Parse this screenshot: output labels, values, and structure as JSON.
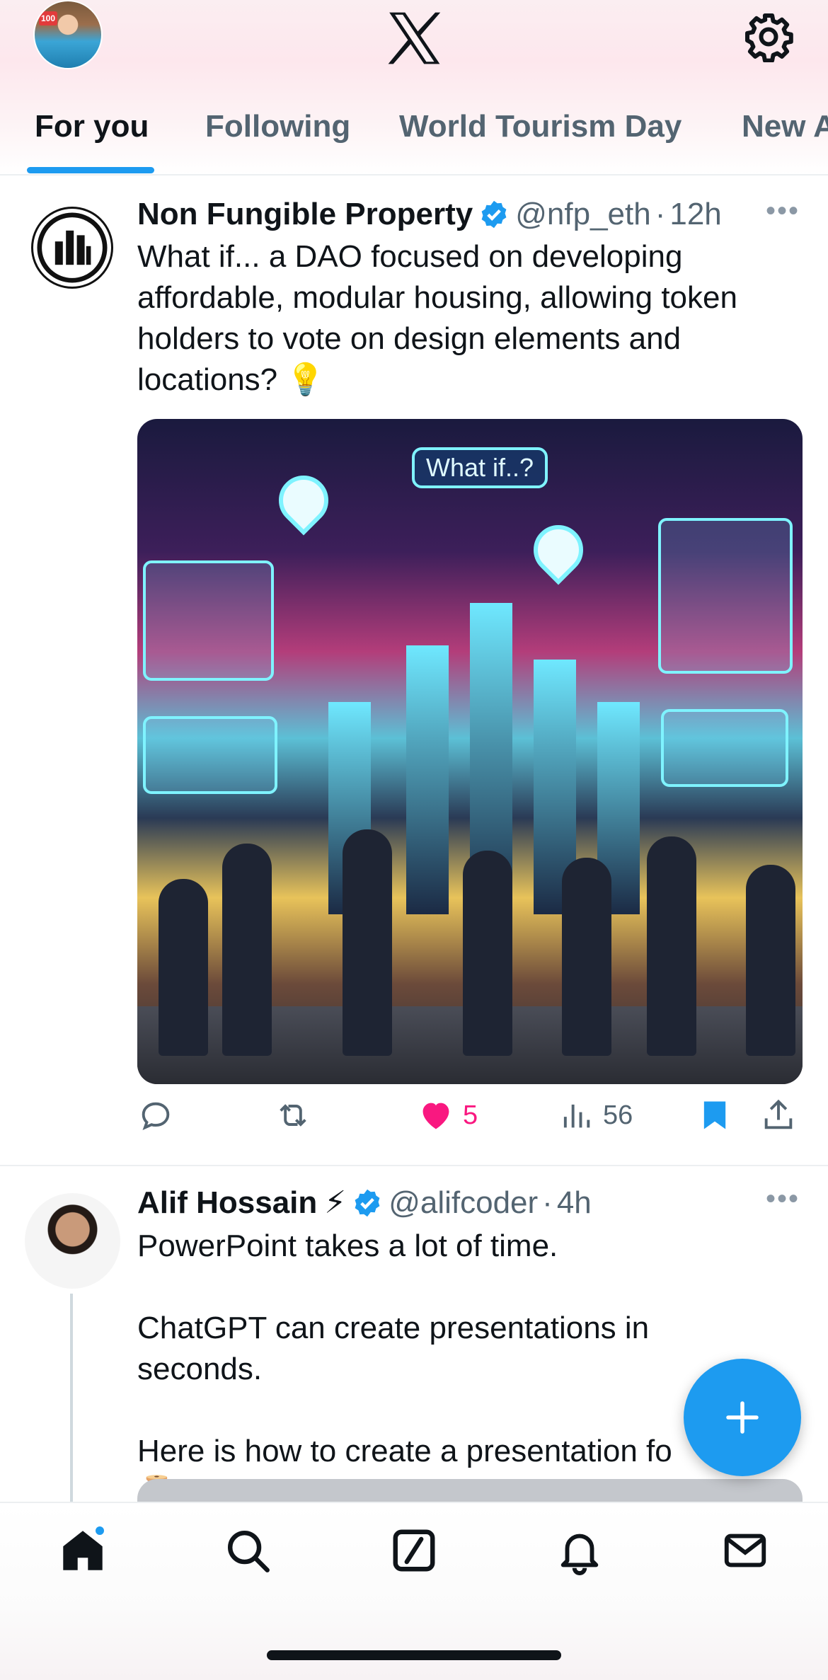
{
  "header": {
    "logo": "x-logo",
    "avatar_badge": "100",
    "settings_icon": "gear-icon"
  },
  "tabs": [
    {
      "label": "For you",
      "active": true
    },
    {
      "label": "Following",
      "active": false
    },
    {
      "label": "World Tourism Day",
      "active": false
    },
    {
      "label": "New A",
      "active": false
    }
  ],
  "posts": [
    {
      "name": "Non Fungible Property",
      "verified": true,
      "handle": "@nfp_eth",
      "dot": "·",
      "time": "12h",
      "text": "What if... a DAO focused on developing affordable, modular housing, allowing token holders to vote on design elements and locations? 💡",
      "media_caption": "What if..?",
      "actions": {
        "reply_count": "",
        "repost_count": "",
        "like_count": "5",
        "liked": true,
        "views_count": "56",
        "bookmarked": true
      }
    },
    {
      "name": "Alif Hossain",
      "name_emoji": "⚡",
      "verified": true,
      "handle": "@alifcoder",
      "dot": "·",
      "time": "4h",
      "text": "PowerPoint takes a lot of time.\n\nChatGPT can create presentations in seconds.\n\nHere is how to create a presentation fo\n🧵 :"
    }
  ],
  "fab": {
    "icon": "plus-icon"
  },
  "bottom_nav": [
    {
      "icon": "home-icon",
      "active": true,
      "has_dot": true
    },
    {
      "icon": "search-icon",
      "active": false
    },
    {
      "icon": "grok-icon",
      "active": false
    },
    {
      "icon": "bell-icon",
      "active": false
    },
    {
      "icon": "mail-icon",
      "active": false
    }
  ],
  "colors": {
    "accent": "#1d9bf0",
    "like": "#f91880",
    "text": "#0f1419",
    "secondary": "#536471"
  }
}
